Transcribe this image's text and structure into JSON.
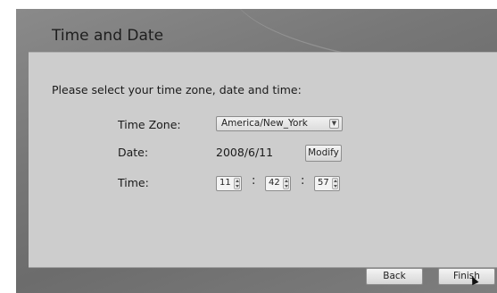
{
  "window": {
    "title": "Time and Date"
  },
  "form": {
    "instruction": "Please select your time zone, date and time:",
    "time_zone": {
      "label": "Time Zone:",
      "value": "America/New_York"
    },
    "date": {
      "label": "Date:",
      "value": "2008/6/11",
      "modify_label": "Modify"
    },
    "time": {
      "label": "Time:",
      "hours": "11",
      "minutes": "42",
      "seconds": "57",
      "separator": ":"
    }
  },
  "footer": {
    "back_label": "Back",
    "finish_label": "Finish"
  },
  "icons": {
    "combo_arrow": "chevron-down-icon",
    "spinner": "spinner-arrows-icon",
    "cursor": "mouse-pointer-icon"
  }
}
